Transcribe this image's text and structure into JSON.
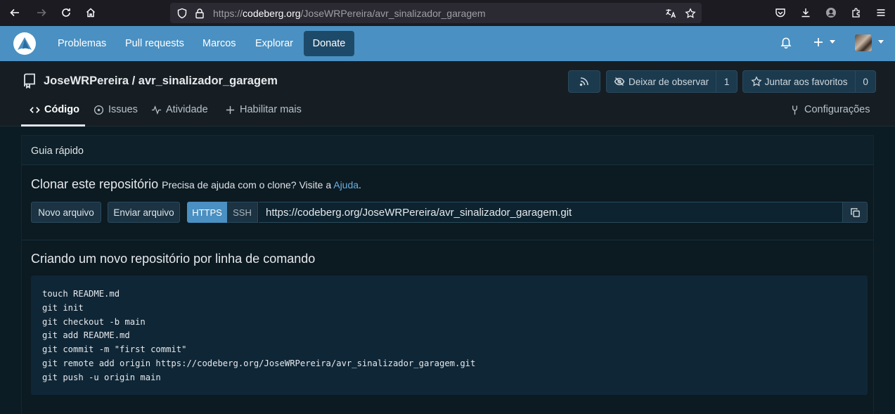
{
  "browser": {
    "url_prefix": "https://",
    "url_host": "codeberg.org",
    "url_path": "/JoseWRPereira/avr_sinalizador_garagem"
  },
  "nav": {
    "items": [
      "Problemas",
      "Pull requests",
      "Marcos",
      "Explorar"
    ],
    "donate": "Donate"
  },
  "repo": {
    "title": "JoseWRPereira / avr_sinalizador_garagem",
    "watch_label": "Deixar de observar",
    "watch_count": "1",
    "star_label": "Juntar aos favoritos",
    "star_count": "0"
  },
  "tabs": {
    "code": "Código",
    "issues": "Issues",
    "activity": "Atividade",
    "enable_more": "Habilitar mais",
    "settings": "Configurações"
  },
  "quick_guide": {
    "title": "Guia rápido",
    "clone_title": "Clonar este repositório",
    "clone_help_prefix": "Precisa de ajuda com o clone? Visite a ",
    "clone_help_link": "Ajuda",
    "clone_help_suffix": ".",
    "new_file": "Novo arquivo",
    "upload_file": "Enviar arquivo",
    "https": "HTTPS",
    "ssh": "SSH",
    "clone_url": "https://codeberg.org/JoseWRPereira/avr_sinalizador_garagem.git",
    "cli_title": "Criando um novo repositório por linha de comando",
    "commands": [
      "touch README.md",
      "git init",
      "git checkout -b main",
      "git add README.md",
      "git commit -m \"first commit\"",
      "git remote add origin https://codeberg.org/JoseWRPereira/avr_sinalizador_garagem.git",
      "git push -u origin main"
    ]
  },
  "colors": {
    "accent": "#4a90c2",
    "background": "#0c1c24"
  }
}
